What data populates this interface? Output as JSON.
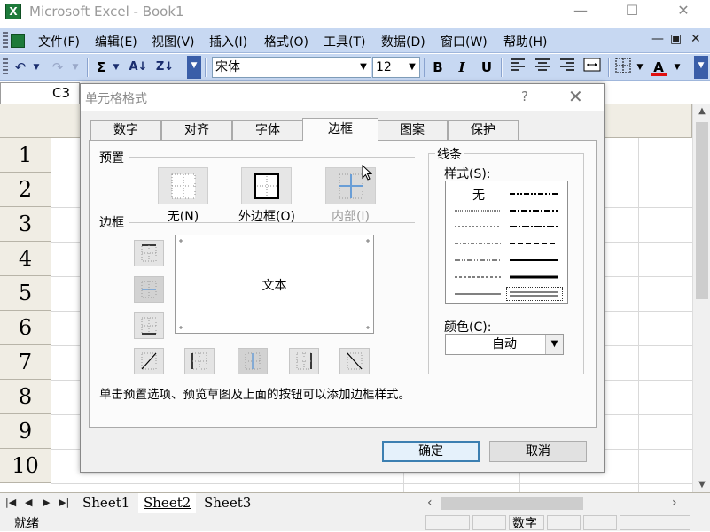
{
  "window": {
    "title": "Microsoft Excel - Book1",
    "minimize": "—",
    "maximize": "☐",
    "close": "✕"
  },
  "menu": {
    "items": [
      "文件(F)",
      "编辑(E)",
      "视图(V)",
      "插入(I)",
      "格式(O)",
      "工具(T)",
      "数据(D)",
      "窗口(W)",
      "帮助(H)"
    ],
    "doc_minimize": "—",
    "doc_restore": "▣",
    "doc_close": "✕"
  },
  "toolbar": {
    "undo": "↶",
    "redo": "↷",
    "sum": "Σ",
    "sort_asc": "A↓",
    "sort_desc": "Z↓",
    "font_name": "宋体",
    "font_size": "12",
    "bold": "B",
    "italic": "I",
    "underline": "U",
    "font_color_letter": "A",
    "font_color": "#e01010"
  },
  "namebox": {
    "value": "C3"
  },
  "grid": {
    "rows": [
      "1",
      "2",
      "3",
      "4",
      "5",
      "6",
      "7",
      "8",
      "9",
      "10"
    ]
  },
  "sheets": {
    "tabs": [
      "Sheet1",
      "Sheet2",
      "Sheet3"
    ],
    "active": "Sheet2"
  },
  "status": {
    "ready": "就绪",
    "numlock": "数字"
  },
  "dialog": {
    "title": "单元格格式",
    "help": "?",
    "close": "✕",
    "tabs": [
      "数字",
      "对齐",
      "字体",
      "边框",
      "图案",
      "保护"
    ],
    "active_tab": "边框",
    "preset_group": "预置",
    "presets": [
      {
        "label": "无(N)",
        "icon": "no-border-icon"
      },
      {
        "label": "外边框(O)",
        "icon": "outline-border-icon"
      },
      {
        "label": "内部(I)",
        "icon": "inside-border-icon",
        "disabled": true
      }
    ],
    "border_group": "边框",
    "preview_text": "文本",
    "help_text": "单击预置选项、预览草图及上面的按钮可以添加边框样式。",
    "line_group": "线条",
    "style_label": "样式(S):",
    "style_none": "无",
    "color_label": "颜色(C):",
    "color_value": "自动",
    "ok": "确定",
    "cancel": "取消"
  }
}
